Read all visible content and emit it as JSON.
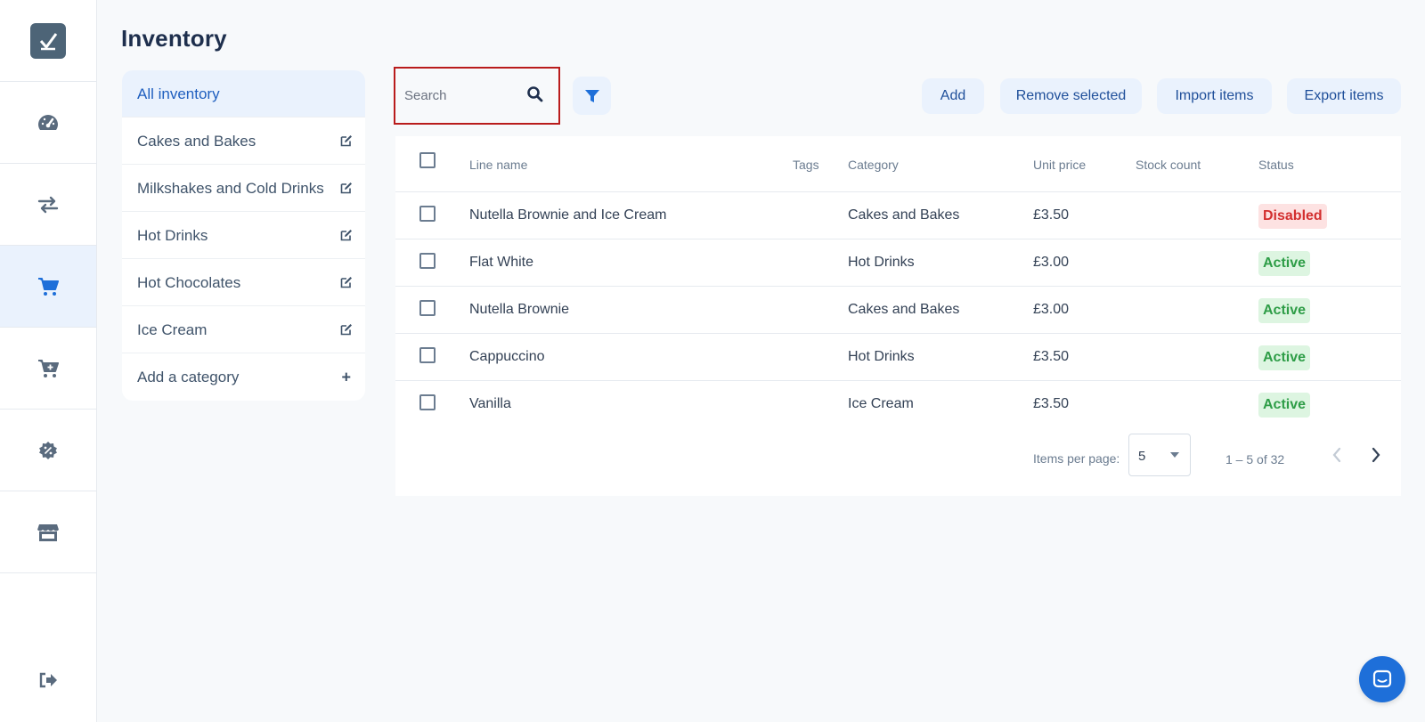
{
  "page": {
    "title": "Inventory"
  },
  "sidebar": {
    "items": [
      {
        "name": "dashboard",
        "icon": "gauge-icon"
      },
      {
        "name": "transactions",
        "icon": "swap-arrows-icon"
      },
      {
        "name": "inventory",
        "icon": "cart-icon",
        "active": true
      },
      {
        "name": "orders",
        "icon": "cart-plus-icon"
      },
      {
        "name": "discounts",
        "icon": "percent-badge-icon"
      },
      {
        "name": "store",
        "icon": "store-icon"
      }
    ],
    "logout_icon": "logout-icon"
  },
  "categories": {
    "items": [
      {
        "label": "All inventory",
        "active": true
      },
      {
        "label": "Cakes and Bakes",
        "editable": true
      },
      {
        "label": "Milkshakes and Cold Drinks",
        "editable": true
      },
      {
        "label": "Hot Drinks",
        "editable": true
      },
      {
        "label": "Hot Chocolates",
        "editable": true
      },
      {
        "label": "Ice Cream",
        "editable": true
      }
    ],
    "add_label": "Add a category"
  },
  "toolbar": {
    "search_placeholder": "Search",
    "add_label": "Add",
    "remove_label": "Remove selected",
    "import_label": "Import items",
    "export_label": "Export items"
  },
  "table": {
    "headers": {
      "line_name": "Line name",
      "tags": "Tags",
      "category": "Category",
      "unit_price": "Unit price",
      "stock_count": "Stock count",
      "status": "Status"
    },
    "rows": [
      {
        "name": "Nutella Brownie and Ice Cream",
        "tags": "",
        "category": "Cakes and Bakes",
        "price": "£3.50",
        "stock": "",
        "status": "Disabled"
      },
      {
        "name": "Flat White",
        "tags": "",
        "category": "Hot Drinks",
        "price": "£3.00",
        "stock": "",
        "status": "Active"
      },
      {
        "name": "Nutella Brownie",
        "tags": "",
        "category": "Cakes and Bakes",
        "price": "£3.00",
        "stock": "",
        "status": "Active"
      },
      {
        "name": "Cappuccino",
        "tags": "",
        "category": "Hot Drinks",
        "price": "£3.50",
        "stock": "",
        "status": "Active"
      },
      {
        "name": "Vanilla",
        "tags": "",
        "category": "Ice Cream",
        "price": "£3.50",
        "stock": "",
        "status": "Active"
      }
    ]
  },
  "pagination": {
    "items_per_page_label": "Items per page:",
    "items_per_page": "5",
    "range": "1 – 5 of 32"
  },
  "colors": {
    "accent": "#1e6fd9",
    "active_badge_bg": "#ddf5e1",
    "active_badge_text": "#2e9d47",
    "disabled_badge_bg": "#fde2e2",
    "disabled_badge_text": "#d32f2f"
  }
}
